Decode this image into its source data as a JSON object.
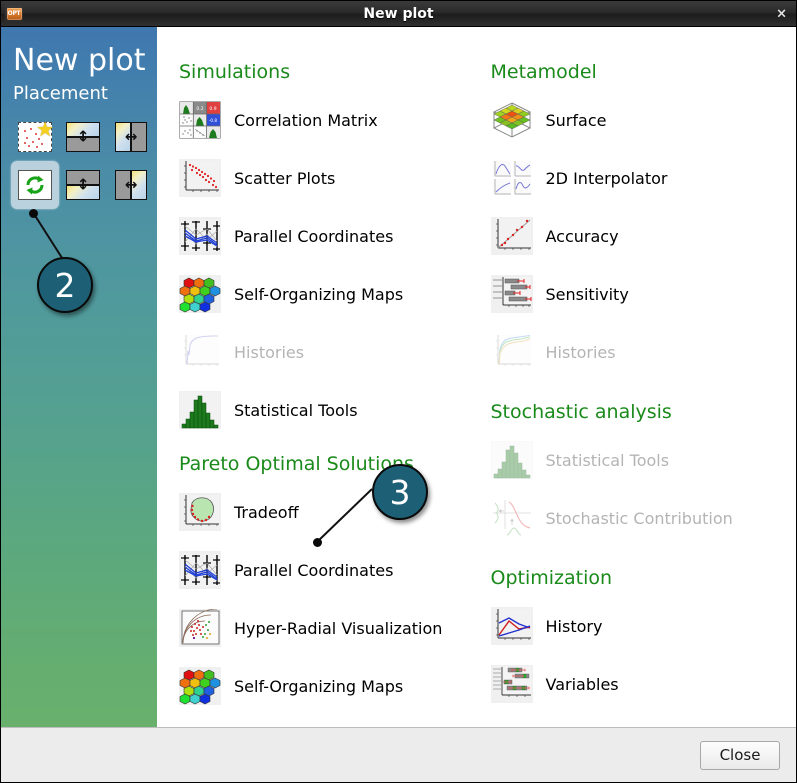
{
  "window": {
    "title": "New plot",
    "app_icon": "opt-folder-icon",
    "icon_label": "OPT",
    "close_glyph": "×"
  },
  "sidebar": {
    "title": "New plot",
    "subtitle": "Placement",
    "placement_options": [
      {
        "name": "new-window",
        "icon": "new-plot-star-icon",
        "selected": false
      },
      {
        "name": "split-horizontal-top",
        "icon": "split-horizontal-top-icon",
        "selected": false
      },
      {
        "name": "split-vertical-left",
        "icon": "split-vertical-left-icon",
        "selected": false
      },
      {
        "name": "reuse-current",
        "icon": "reuse-recycle-icon",
        "selected": true
      },
      {
        "name": "split-horizontal-bottom",
        "icon": "split-horizontal-bottom-icon",
        "selected": false
      },
      {
        "name": "split-vertical-right",
        "icon": "split-vertical-right-icon",
        "selected": false
      }
    ]
  },
  "callouts": [
    {
      "label": "2"
    },
    {
      "label": "3"
    }
  ],
  "content": {
    "left_groups": [
      {
        "title": "Simulations",
        "items": [
          {
            "label": "Correlation Matrix",
            "icon": "correlation-matrix-icon",
            "disabled": false
          },
          {
            "label": "Scatter Plots",
            "icon": "scatter-plots-icon",
            "disabled": false
          },
          {
            "label": "Parallel Coordinates",
            "icon": "parallel-coordinates-icon",
            "disabled": false
          },
          {
            "label": "Self-Organizing Maps",
            "icon": "self-organizing-maps-icon",
            "disabled": false
          },
          {
            "label": "Histories",
            "icon": "histories-icon",
            "disabled": true
          },
          {
            "label": "Statistical Tools",
            "icon": "statistical-tools-icon",
            "disabled": false
          }
        ]
      },
      {
        "title": "Pareto Optimal Solutions",
        "items": [
          {
            "label": "Tradeoff",
            "icon": "tradeoff-icon",
            "disabled": false
          },
          {
            "label": "Parallel Coordinates",
            "icon": "parallel-coordinates-icon",
            "disabled": false
          },
          {
            "label": "Hyper-Radial Visualization",
            "icon": "hyper-radial-visualization-icon",
            "disabled": false
          },
          {
            "label": "Self-Organizing Maps",
            "icon": "self-organizing-maps-icon",
            "disabled": false
          }
        ]
      }
    ],
    "right_groups": [
      {
        "title": "Metamodel",
        "items": [
          {
            "label": "Surface",
            "icon": "surface-icon",
            "disabled": false
          },
          {
            "label": "2D Interpolator",
            "icon": "2d-interpolator-icon",
            "disabled": false
          },
          {
            "label": "Accuracy",
            "icon": "accuracy-icon",
            "disabled": false
          },
          {
            "label": "Sensitivity",
            "icon": "sensitivity-icon",
            "disabled": false
          },
          {
            "label": "Histories",
            "icon": "histories-icon",
            "disabled": true
          }
        ]
      },
      {
        "title": "Stochastic analysis",
        "items": [
          {
            "label": "Statistical Tools",
            "icon": "statistical-tools-icon",
            "disabled": true
          },
          {
            "label": "Stochastic Contribution",
            "icon": "stochastic-contribution-icon",
            "disabled": true
          }
        ]
      },
      {
        "title": "Optimization",
        "items": [
          {
            "label": "History",
            "icon": "optimization-history-icon",
            "disabled": false
          },
          {
            "label": "Variables",
            "icon": "variables-icon",
            "disabled": false
          }
        ]
      }
    ]
  },
  "footer": {
    "close_label": "Close"
  },
  "colors": {
    "group_title": "#1a8a1a",
    "callout_fill": "#1d6076",
    "sidebar_top": "#3f77ae",
    "sidebar_bottom": "#68b06c",
    "disabled_text": "#b4b4b4"
  }
}
